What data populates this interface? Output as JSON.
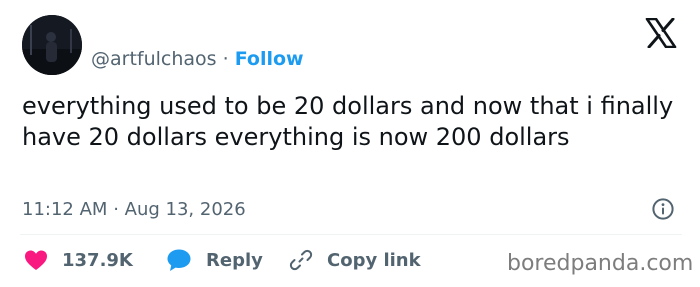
{
  "tweet": {
    "author": {
      "handle": "@artfulchaos",
      "separator": "·",
      "follow_label": "Follow"
    },
    "text": "everything used to be 20 dollars and now that i finally have 20 dollars everything is now 200 dollars",
    "time": "11:12 AM",
    "meta_separator": "·",
    "date": "Aug 13, 2026"
  },
  "actions": {
    "likes_count": "137.9K",
    "reply_label": "Reply",
    "copy_link_label": "Copy link"
  },
  "watermark": "boredpanda.com",
  "icons": {
    "brand": "x-logo-icon",
    "info": "info-icon",
    "like": "heart-icon",
    "reply": "reply-bubble-icon",
    "copy": "link-icon"
  },
  "colors": {
    "text": "#0f1419",
    "secondary": "#536471",
    "accent": "#1d9bf0",
    "like": "#f91880",
    "watermark": "#7d7d7d"
  }
}
